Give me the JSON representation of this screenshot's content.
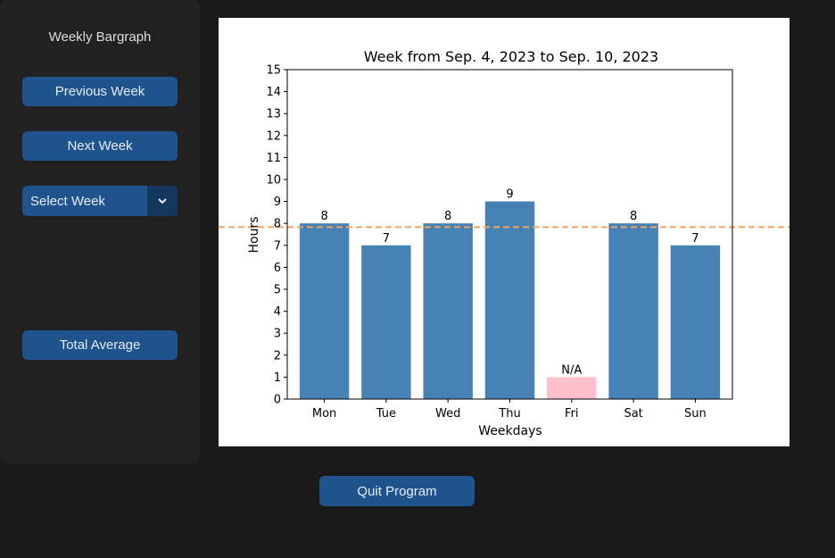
{
  "sidebar": {
    "title": "Weekly Bargraph",
    "previous_label": "Previous Week",
    "next_label": "Next Week",
    "select_value": "Select Week",
    "total_average_label": "Total Average"
  },
  "quit_label": "Quit Program",
  "colors": {
    "bar": "#4682b4",
    "missing_bar": "#ffc0cb",
    "average_line": "#f4a460",
    "button": "#1f538d"
  },
  "chart_data": {
    "type": "bar",
    "title": "Week from Sep. 4, 2023 to Sep. 10, 2023",
    "xlabel": "Weekdays",
    "ylabel": "Hours",
    "ylim": [
      0,
      15
    ],
    "yticks": [
      0,
      1,
      2,
      3,
      4,
      5,
      6,
      7,
      8,
      9,
      10,
      11,
      12,
      13,
      14,
      15
    ],
    "categories": [
      "Mon",
      "Tue",
      "Wed",
      "Thu",
      "Fri",
      "Sat",
      "Sun"
    ],
    "values": [
      8,
      7,
      8,
      9,
      1,
      8,
      7
    ],
    "bar_labels": [
      "8",
      "7",
      "8",
      "9",
      "N/A",
      "8",
      "7"
    ],
    "missing": [
      false,
      false,
      false,
      false,
      true,
      false,
      false
    ],
    "average_line": 7.83,
    "grid": false
  }
}
